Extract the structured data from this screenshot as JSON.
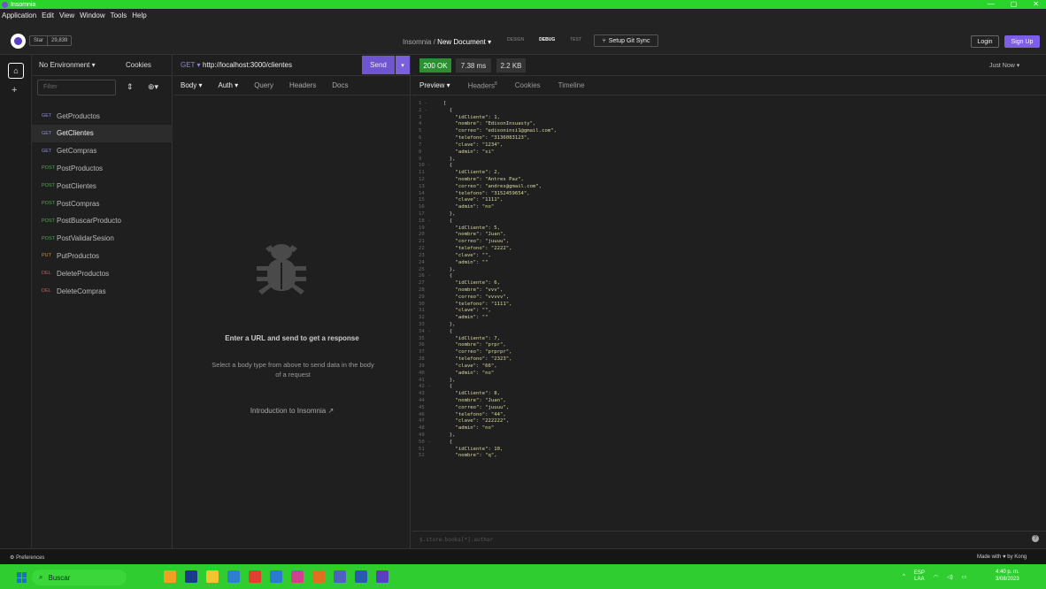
{
  "window": {
    "title": "Insomnia",
    "controls": [
      "—",
      "▢",
      "✕"
    ]
  },
  "menu": [
    "Application",
    "Edit",
    "View",
    "Window",
    "Tools",
    "Help"
  ],
  "header": {
    "star_label": "Star",
    "star_count": "29,839",
    "breadcrumb_app": "Insomnia",
    "breadcrumb_sep": "/",
    "breadcrumb_doc": "New Document ▾",
    "modes": [
      "DESIGN",
      "DEBUG",
      "TEST"
    ],
    "git_sync": "Setup Git Sync",
    "login": "Login",
    "signup": "Sign Up"
  },
  "sidebar": {
    "environment": "No Environment ▾",
    "cookies": "Cookies",
    "filter_placeholder": "Filter",
    "requests": [
      {
        "method": "GET",
        "name": "GetProductos",
        "color": "#8c8cd8"
      },
      {
        "method": "GET",
        "name": "GetClientes",
        "color": "#8c8cd8"
      },
      {
        "method": "GET",
        "name": "GetCompras",
        "color": "#8c8cd8"
      },
      {
        "method": "POST",
        "name": "PostProductos",
        "color": "#4ab14e"
      },
      {
        "method": "POST",
        "name": "PostClientes",
        "color": "#4ab14e"
      },
      {
        "method": "POST",
        "name": "PostCompras",
        "color": "#4ab14e"
      },
      {
        "method": "POST",
        "name": "PostBuscarProducto",
        "color": "#4ab14e"
      },
      {
        "method": "POST",
        "name": "PostValidarSesion",
        "color": "#4ab14e"
      },
      {
        "method": "PUT",
        "name": "PutProductos",
        "color": "#e08a2a"
      },
      {
        "method": "DEL",
        "name": "DeleteProductos",
        "color": "#e05050"
      },
      {
        "method": "DEL",
        "name": "DeleteCompras",
        "color": "#e05050"
      }
    ]
  },
  "request": {
    "method": "GET ▾",
    "url": "http://localhost:3000/clientes",
    "send": "Send",
    "tabs": [
      "Body ▾",
      "Auth ▾",
      "Query",
      "Headers",
      "Docs"
    ],
    "empty_title": "Enter a URL and send to get a response",
    "empty_sub": "Select a body type from above to send data in the body of a request",
    "intro": "Introduction to Insomnia"
  },
  "response": {
    "status": "200 OK",
    "time": "7.38 ms",
    "size": "2.2 KB",
    "when": "Just Now ▾",
    "tabs": [
      "Preview ▾",
      "Headers",
      "Cookies",
      "Timeline"
    ],
    "headers_count": "8",
    "filter_placeholder": "$.store.books[*].author",
    "lines": [
      [
        "1 -",
        "["
      ],
      [
        "2 -",
        "  {"
      ],
      [
        "3",
        "    \"idCliente\": 1,"
      ],
      [
        "4",
        "    \"nombre\": \"EdisonInsuasty\","
      ],
      [
        "5",
        "    \"correo\": \"edisoninsi1@gmail.com\","
      ],
      [
        "6",
        "    \"telefono\": \"3136083123\","
      ],
      [
        "7",
        "    \"clave\": \"1234\","
      ],
      [
        "8",
        "    \"admin\": \"si\""
      ],
      [
        "9",
        "  },"
      ],
      [
        "10 -",
        "  {"
      ],
      [
        "11",
        "    \"idCliente\": 2,"
      ],
      [
        "12",
        "    \"nombre\": \"Antres Paz\","
      ],
      [
        "13",
        "    \"correo\": \"andres@gmail.com\","
      ],
      [
        "14",
        "    \"telefono\": \"3152459654\","
      ],
      [
        "15",
        "    \"clave\": \"1111\","
      ],
      [
        "16",
        "    \"admin\": \"no\""
      ],
      [
        "17",
        "  },"
      ],
      [
        "18 -",
        "  {"
      ],
      [
        "19",
        "    \"idCliente\": 5,"
      ],
      [
        "20",
        "    \"nombre\": \"Juan\","
      ],
      [
        "21",
        "    \"correo\": \"juuuu\","
      ],
      [
        "22",
        "    \"telefono\": \"2222\","
      ],
      [
        "23",
        "    \"clave\": \"\","
      ],
      [
        "24",
        "    \"admin\": \"\""
      ],
      [
        "25",
        "  },"
      ],
      [
        "26 -",
        "  {"
      ],
      [
        "27",
        "    \"idCliente\": 6,"
      ],
      [
        "28",
        "    \"nombre\": \"vvv\","
      ],
      [
        "29",
        "    \"correo\": \"vvvvv\","
      ],
      [
        "30",
        "    \"telefono\": \"1111\","
      ],
      [
        "31",
        "    \"clave\": \"\","
      ],
      [
        "32",
        "    \"admin\": \"\""
      ],
      [
        "33",
        "  },"
      ],
      [
        "34 -",
        "  {"
      ],
      [
        "35",
        "    \"idCliente\": 7,"
      ],
      [
        "36",
        "    \"nombre\": \"prpr\","
      ],
      [
        "37",
        "    \"correo\": \"prprpr\","
      ],
      [
        "38",
        "    \"telefono\": \"2323\","
      ],
      [
        "39",
        "    \"clave\": \"66\","
      ],
      [
        "40",
        "    \"admin\": \"no\""
      ],
      [
        "41",
        "  },"
      ],
      [
        "42 -",
        "  {"
      ],
      [
        "43",
        "    \"idCliente\": 8,"
      ],
      [
        "44",
        "    \"nombre\": \"Juan\","
      ],
      [
        "45",
        "    \"correo\": \"juuuu\","
      ],
      [
        "46",
        "    \"telefono\": \"44\","
      ],
      [
        "47",
        "    \"clave\": \"222222\","
      ],
      [
        "48",
        "    \"admin\": \"no\""
      ],
      [
        "49",
        "  },"
      ],
      [
        "50 -",
        "  {"
      ],
      [
        "51",
        "    \"idCliente\": 10,"
      ],
      [
        "52",
        "    \"nombre\": \"q\","
      ]
    ]
  },
  "statusbar": {
    "preferences": "Preferences",
    "made_with": "Made with ♥ by Kong"
  },
  "taskbar": {
    "search": "Buscar",
    "lang": "ESP",
    "lang2": "LAA",
    "time": "4:40 p. m.",
    "date": "3/08/2023",
    "apps": [
      {
        "name": "widgets",
        "color": "#f0a020"
      },
      {
        "name": "task-view",
        "color": "#1a3a8a"
      },
      {
        "name": "explorer",
        "color": "#f4c430"
      },
      {
        "name": "store",
        "color": "#2f7fd0"
      },
      {
        "name": "chrome",
        "color": "#e04030"
      },
      {
        "name": "vscode",
        "color": "#2a7ad0"
      },
      {
        "name": "gallery",
        "color": "#d04090"
      },
      {
        "name": "sublime",
        "color": "#e07020"
      },
      {
        "name": "teams",
        "color": "#5060c0"
      },
      {
        "name": "word",
        "color": "#2a5ab0"
      },
      {
        "name": "insomnia",
        "color": "#5a3fc0"
      }
    ]
  }
}
